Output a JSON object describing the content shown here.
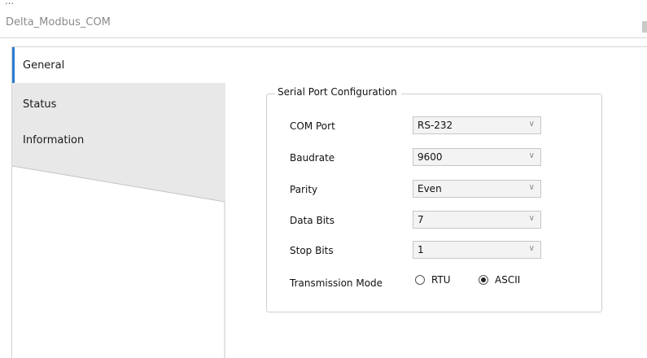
{
  "window": {
    "title": "Delta_Modbus_COM"
  },
  "tabs": [
    {
      "label": "General",
      "active": true
    },
    {
      "label": "Status",
      "active": false
    },
    {
      "label": "Information",
      "active": false
    }
  ],
  "group": {
    "title": "Serial Port Configuration"
  },
  "fields": [
    {
      "label": "COM Port",
      "value": "RS-232"
    },
    {
      "label": "Baudrate",
      "value": "9600"
    },
    {
      "label": "Parity",
      "value": "Even"
    },
    {
      "label": "Data Bits",
      "value": "7"
    },
    {
      "label": "Stop Bits",
      "value": "1"
    }
  ],
  "transmission": {
    "label": "Transmission Mode",
    "options": [
      {
        "label": "RTU",
        "selected": false
      },
      {
        "label": "ASCII",
        "selected": true
      }
    ]
  },
  "icons": {
    "dropdown": "chevron-down-icon",
    "radio": "radio-button-icon"
  },
  "colors": {
    "accent": "#2b7cd3",
    "tab_inactive": "#e8e8e8"
  }
}
